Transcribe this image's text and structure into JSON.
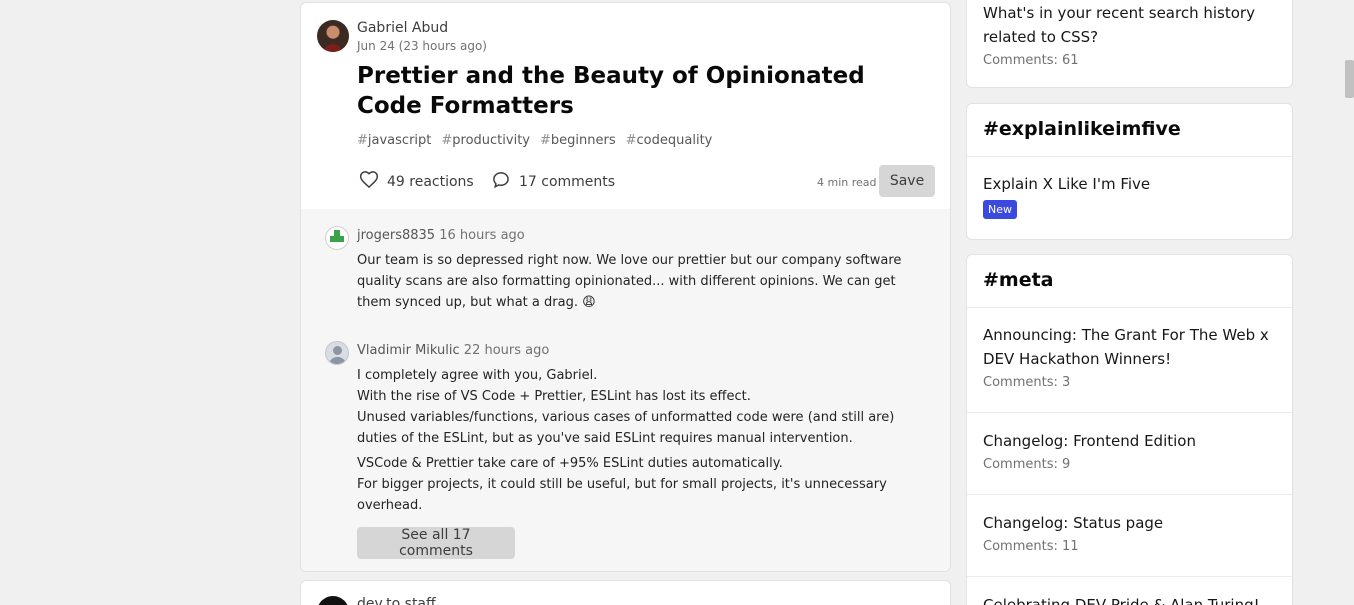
{
  "article": {
    "author_name": "Gabriel Abud",
    "date": "Jun 24 (23 hours ago)",
    "title": "Prettier and the Beauty of Opinionated Code Formatters",
    "tags": [
      "javascript",
      "productivity",
      "beginners",
      "codequality"
    ],
    "reactions_label": "49 reactions",
    "comments_label": "17 comments",
    "read_time": "4 min read",
    "save_label": "Save"
  },
  "comments": [
    {
      "author": "jrogers8835",
      "time": "16 hours ago",
      "paragraphs": [
        "Our team is so depressed right now. We love our prettier but our company software quality scans are also formatting opinionated... with different opinions. We can get them synced up, but what a drag. 😩"
      ]
    },
    {
      "author": "Vladimir Mikulic",
      "time": "22 hours ago",
      "paragraphs": [
        "I completely agree with you, Gabriel.",
        "With the rise of VS Code + Prettier, ESLint has lost its effect.",
        "Unused variables/functions, various cases of unformatted code were (and still are) duties of the ESLint, but as you've said ESLint requires manual intervention.",
        "VSCode & Prettier take care of +95% ESLint duties automatically.",
        "For bigger projects, it could still be useful, but for small projects, it's unnecessary overhead."
      ]
    }
  ],
  "see_all_label": "See all 17 comments",
  "next_post": {
    "author_name": "dev.to staff"
  },
  "sidebar": {
    "top_item": {
      "title": "What's in your recent search history related to CSS?",
      "comments": "Comments: 61"
    },
    "explain": {
      "heading": "#explainlikeimfive",
      "item_title": "Explain X Like I'm Five",
      "badge": "New"
    },
    "meta": {
      "heading": "#meta",
      "items": [
        {
          "title": "Announcing: The Grant For The Web x DEV Hackathon Winners!",
          "comments": "Comments: 3"
        },
        {
          "title": "Changelog: Frontend Edition",
          "comments": "Comments: 9"
        },
        {
          "title": "Changelog: Status page",
          "comments": "Comments: 11"
        },
        {
          "title": "Celebrating DEV Pride & Alan Turing!",
          "comments": ""
        }
      ]
    }
  },
  "colors": {
    "badge": "#3b49df",
    "page_bg": "#f0f0f0",
    "button_bg": "#d6d6d6"
  }
}
